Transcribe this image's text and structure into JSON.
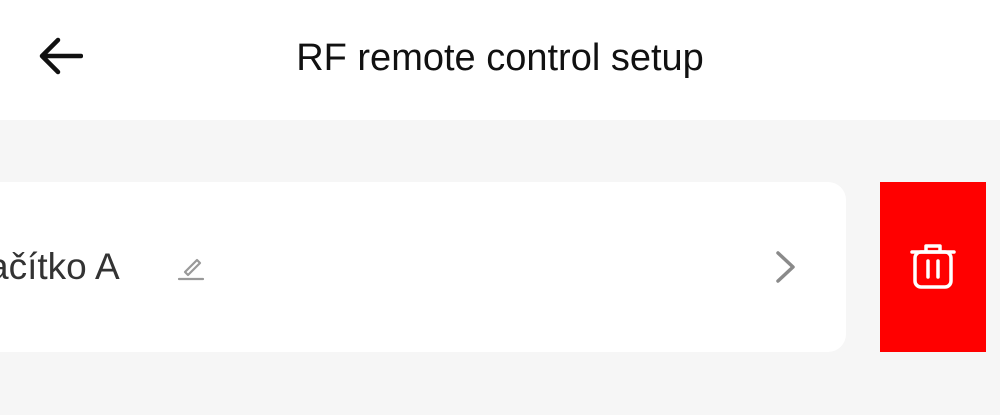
{
  "header": {
    "title": "RF remote control setup",
    "back_icon": "arrow-left-icon"
  },
  "list": {
    "items": [
      {
        "label": "ačítko A",
        "edit_icon": "pencil-icon",
        "chevron_icon": "chevron-right-icon",
        "delete_icon": "trash-icon"
      }
    ]
  },
  "colors": {
    "header_bg": "#ffffff",
    "page_bg": "#f6f6f6",
    "delete_bg": "#ff0000",
    "text": "#111111"
  }
}
